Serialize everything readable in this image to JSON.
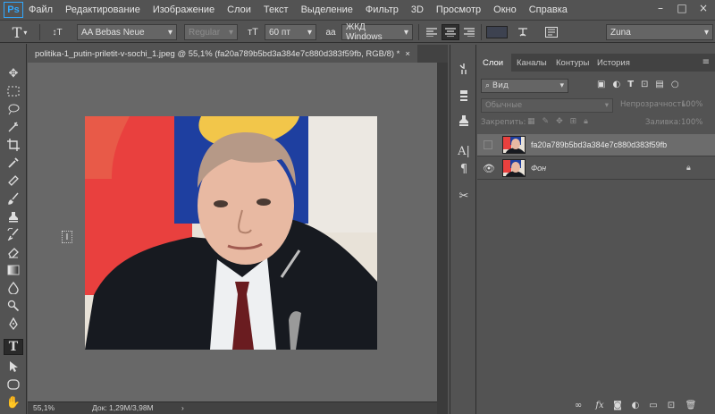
{
  "app": {
    "logo": "Ps"
  },
  "menu": [
    "Файл",
    "Редактирование",
    "Изображение",
    "Слои",
    "Текст",
    "Выделение",
    "Фильтр",
    "3D",
    "Просмотр",
    "Окно",
    "Справка"
  ],
  "window_controls": {
    "minimize": "–",
    "maximize": "□",
    "close": "×"
  },
  "options": {
    "tool_glyph": "T",
    "orient_glyph": "↕T",
    "font_family": "AA Bebas Neue",
    "font_style": "Regular",
    "size_glyph": "тT",
    "font_size": "60 пт",
    "aa_glyph": "aa",
    "antialias": "ЖКД Windows",
    "workspace": "Zuna"
  },
  "document": {
    "tab_title": "politika-1_putin-priletit-v-sochi_1.jpeg @ 55,1% (fa20a789b5bd3a384e7c880d383f59fb, RGB/8) *",
    "tab_close": "×",
    "zoom": "55,1%",
    "doc_size": "Док: 1,29M/3,98M",
    "scroll_arrow": "›"
  },
  "layers_panel": {
    "tabs": [
      "Слои",
      "Каналы",
      "Контуры",
      "История"
    ],
    "kind_filter": "Вид",
    "blend_mode": "Обычные",
    "opacity_label": "Непрозрачность:",
    "opacity_value": "100%",
    "lock_label": "Закрепить:",
    "fill_label": "Заливка:",
    "fill_value": "100%",
    "layers": [
      {
        "name": "fa20a789b5bd3a384e7c880d383f59fb",
        "visible": false,
        "selected": true,
        "italic": false
      },
      {
        "name": "Фон",
        "visible": true,
        "selected": false,
        "italic": true
      }
    ]
  },
  "colors": {
    "accent": "#31a8ff",
    "canvas_bg": "#686868",
    "selected_layer": "#6c6c6c"
  }
}
